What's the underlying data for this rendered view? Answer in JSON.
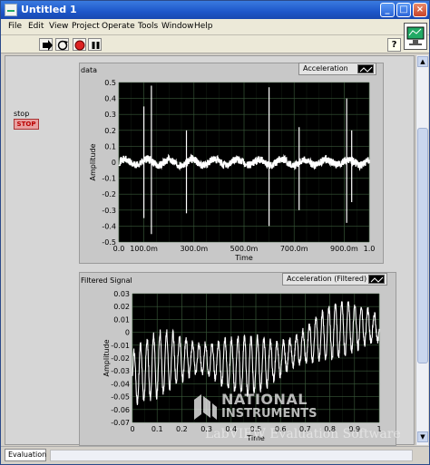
{
  "window": {
    "title": "Untitled 1"
  },
  "menu": [
    "File",
    "Edit",
    "View",
    "Project",
    "Operate",
    "Tools",
    "Window",
    "Help"
  ],
  "toolbar": {
    "help_glyph": "?",
    "icons": [
      "run-arrow-icon",
      "run-continuously-icon",
      "abort-icon",
      "pause-icon"
    ]
  },
  "stop_control": {
    "label": "stop",
    "button_text": "STOP"
  },
  "statusbar": {
    "tab_label": "Evaluation"
  },
  "watermark": {
    "line1": "NATIONAL",
    "line2": "INSTRUMENTS",
    "line3": "LabVIEW Evaluation Software"
  },
  "colors": {
    "plot_bg": "#000000",
    "trace": "#ffffff",
    "grid": "#3a5a3a",
    "stop_text": "#b00000"
  },
  "chart_data": [
    {
      "type": "line",
      "label": "data",
      "legend": "Acceleration",
      "xlabel": "Time",
      "ylabel": "Amplitude",
      "xlim": [
        0,
        1.0
      ],
      "ylim": [
        -0.5,
        0.5
      ],
      "xticks": [
        "0.0",
        "100.0m",
        "300.0m",
        "500.0m",
        "700.0m",
        "900.0m",
        "1.0"
      ],
      "xtick_values": [
        0,
        0.1,
        0.3,
        0.5,
        0.7,
        0.9,
        1.0
      ],
      "yticks": [
        "0.5",
        "0.4",
        "0.3",
        "0.2",
        "0.1",
        "0",
        "-0.1",
        "-0.2",
        "-0.3",
        "-0.4",
        "-0.5"
      ],
      "ytick_values": [
        0.5,
        0.4,
        0.3,
        0.2,
        0.1,
        0,
        -0.1,
        -0.2,
        -0.3,
        -0.4,
        -0.5
      ],
      "grid": true,
      "spikes": [
        {
          "t": 0.1,
          "high": 0.35,
          "low": -0.35
        },
        {
          "t": 0.13,
          "high": 0.48,
          "low": -0.45
        },
        {
          "t": 0.27,
          "high": 0.2,
          "low": -0.32
        },
        {
          "t": 0.6,
          "high": 0.47,
          "low": -0.4
        },
        {
          "t": 0.72,
          "high": 0.22,
          "low": -0.3
        },
        {
          "t": 0.91,
          "high": 0.4,
          "low": -0.38
        },
        {
          "t": 0.93,
          "high": 0.2,
          "low": -0.25
        }
      ],
      "baseline_noise": 0.03
    },
    {
      "type": "line",
      "label": "Filtered Signal",
      "legend": "Acceleration (Filtered)",
      "xlabel": "Time",
      "ylabel": "Amplitude",
      "xlim": [
        0,
        1.0
      ],
      "ylim": [
        -0.07,
        0.03
      ],
      "xticks": [
        "0",
        "0.1",
        "0.2",
        "0.3",
        "0.4",
        "0.5",
        "0.6",
        "0.7",
        "0.8",
        "0.9",
        "1"
      ],
      "xtick_values": [
        0,
        0.1,
        0.2,
        0.3,
        0.4,
        0.5,
        0.6,
        0.7,
        0.8,
        0.9,
        1.0
      ],
      "yticks": [
        "0.03",
        "0.02",
        "0.01",
        "0",
        "-0.01",
        "-0.02",
        "-0.03",
        "-0.04",
        "-0.05",
        "-0.06",
        "-0.07"
      ],
      "ytick_values": [
        0.03,
        0.02,
        0.01,
        0,
        -0.01,
        -0.02,
        -0.03,
        -0.04,
        -0.05,
        -0.06,
        -0.07
      ],
      "grid": true,
      "oscillation": {
        "cycles": 38,
        "start_center": -0.035,
        "end_center": 0.0,
        "start_amp": 0.025,
        "end_amp": 0.02
      }
    }
  ]
}
